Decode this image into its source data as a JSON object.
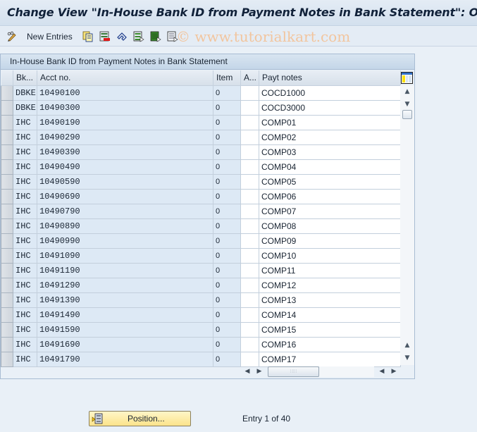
{
  "title": "Change View \"In-House Bank ID from Payment Notes in Bank Statement\": O",
  "toolbar": {
    "new_entries_label": "New Entries",
    "icons": [
      "toggle-display-change-icon",
      "copy-as-icon",
      "delete-icon",
      "undo-change-icon",
      "select-all-icon",
      "select-block-icon",
      "deselect-all-icon"
    ]
  },
  "watermark": "© www.tutorialkart.com",
  "table": {
    "title": "In-House Bank ID from Payment Notes in Bank Statement",
    "columns": [
      "Bk...",
      "Acct no.",
      "Item",
      "A...",
      "Payt notes"
    ],
    "rows": [
      {
        "bank": "DBKE",
        "acct": "10490100",
        "item": "0",
        "a": "",
        "notes": "COCD1000"
      },
      {
        "bank": "DBKE",
        "acct": "10490300",
        "item": "0",
        "a": "",
        "notes": "COCD3000"
      },
      {
        "bank": "IHC",
        "acct": "10490190",
        "item": "0",
        "a": "",
        "notes": "COMP01"
      },
      {
        "bank": "IHC",
        "acct": "10490290",
        "item": "0",
        "a": "",
        "notes": "COMP02"
      },
      {
        "bank": "IHC",
        "acct": "10490390",
        "item": "0",
        "a": "",
        "notes": "COMP03"
      },
      {
        "bank": "IHC",
        "acct": "10490490",
        "item": "0",
        "a": "",
        "notes": "COMP04"
      },
      {
        "bank": "IHC",
        "acct": "10490590",
        "item": "0",
        "a": "",
        "notes": "COMP05"
      },
      {
        "bank": "IHC",
        "acct": "10490690",
        "item": "0",
        "a": "",
        "notes": "COMP06"
      },
      {
        "bank": "IHC",
        "acct": "10490790",
        "item": "0",
        "a": "",
        "notes": "COMP07"
      },
      {
        "bank": "IHC",
        "acct": "10490890",
        "item": "0",
        "a": "",
        "notes": "COMP08"
      },
      {
        "bank": "IHC",
        "acct": "10490990",
        "item": "0",
        "a": "",
        "notes": "COMP09"
      },
      {
        "bank": "IHC",
        "acct": "10491090",
        "item": "0",
        "a": "",
        "notes": "COMP10"
      },
      {
        "bank": "IHC",
        "acct": "10491190",
        "item": "0",
        "a": "",
        "notes": "COMP11"
      },
      {
        "bank": "IHC",
        "acct": "10491290",
        "item": "0",
        "a": "",
        "notes": "COMP12"
      },
      {
        "bank": "IHC",
        "acct": "10491390",
        "item": "0",
        "a": "",
        "notes": "COMP13"
      },
      {
        "bank": "IHC",
        "acct": "10491490",
        "item": "0",
        "a": "",
        "notes": "COMP14"
      },
      {
        "bank": "IHC",
        "acct": "10491590",
        "item": "0",
        "a": "",
        "notes": "COMP15"
      },
      {
        "bank": "IHC",
        "acct": "10491690",
        "item": "0",
        "a": "",
        "notes": "COMP16"
      },
      {
        "bank": "IHC",
        "acct": "10491790",
        "item": "0",
        "a": "",
        "notes": "COMP17"
      }
    ]
  },
  "footer": {
    "position_button_label": "Position...",
    "entry_info": "Entry 1 of 40"
  }
}
